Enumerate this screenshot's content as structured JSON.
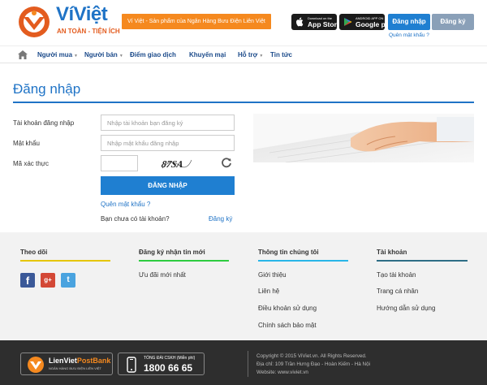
{
  "header": {
    "logo_text": "VíViệt",
    "logo_tagline": "AN TOÀN - TIỆN ÍCH",
    "slogan": "Ví Việt - Sản phẩm của Ngân Hàng Bưu Điện Liên Việt",
    "app_store": {
      "small": "Download on the",
      "large": "App Store"
    },
    "google_play": {
      "small": "ANDROID APP ON",
      "large": "Google play"
    },
    "login_button": "Đăng nhập",
    "register_button": "Đăng ký",
    "forgot_password": "Quên mật khẩu ?"
  },
  "nav": {
    "items": [
      {
        "label": "Người mua",
        "dropdown": true
      },
      {
        "label": "Người bán",
        "dropdown": true
      },
      {
        "label": "Điểm giao dịch",
        "dropdown": false
      },
      {
        "label": "Khuyến mại",
        "dropdown": false
      },
      {
        "label": "Hỗ trợ",
        "dropdown": true
      },
      {
        "label": "Tin tức",
        "dropdown": false
      }
    ]
  },
  "login": {
    "title": "Đăng nhập",
    "account_label": "Tài khoản đăng nhập",
    "account_placeholder": "Nhập tài khoản bạn đăng ký",
    "password_label": "Mật khẩu",
    "password_placeholder": "Nhập mật khẩu đăng nhập",
    "captcha_label": "Mã xác thực",
    "captcha_text": "87SA",
    "submit": "ĐĂNG NHẬP",
    "forgot": "Quên mật khẩu ?",
    "no_account": "Bạn chưa có tài khoản?",
    "register": "Đăng ký"
  },
  "footer": {
    "follow_title": "Theo dõi",
    "social": [
      "f",
      "g+",
      "t"
    ],
    "newsletter_title": "Đăng ký nhận tin mới",
    "newsletter_links": [
      "Ưu đãi mới nhất"
    ],
    "info_title": "Thông tin chúng tôi",
    "info_links": [
      "Giới thiệu",
      "Liên hệ",
      "Điều khoản sử dụng",
      "Chính sách bảo mật"
    ],
    "account_title": "Tài khoản",
    "account_links": [
      "Tạo tài khoản",
      "Trang cá nhân",
      "Hướng dẫn sử dụng"
    ]
  },
  "bottom": {
    "bank_name_a": "LienViet",
    "bank_name_b": "PostBank",
    "bank_sub": "NGÂN HÀNG BƯU ĐIỆN LIÊN VIỆT",
    "hotline_label": "TỔNG ĐÀI CSKH (Miễn phí)",
    "hotline_number": "1800 66 65",
    "copyright": "Copyright © 2015 ViViet.vn. All Rights Reserved.",
    "address": "Địa chỉ: 109 Trần Hưng Đạo - Hoàn Kiếm - Hà Nội",
    "website": "Website: www.viviet.vn"
  },
  "colors": {
    "brand_blue": "#1f73c6",
    "brand_orange": "#f5891f",
    "register_grey": "#8aa0b8"
  }
}
